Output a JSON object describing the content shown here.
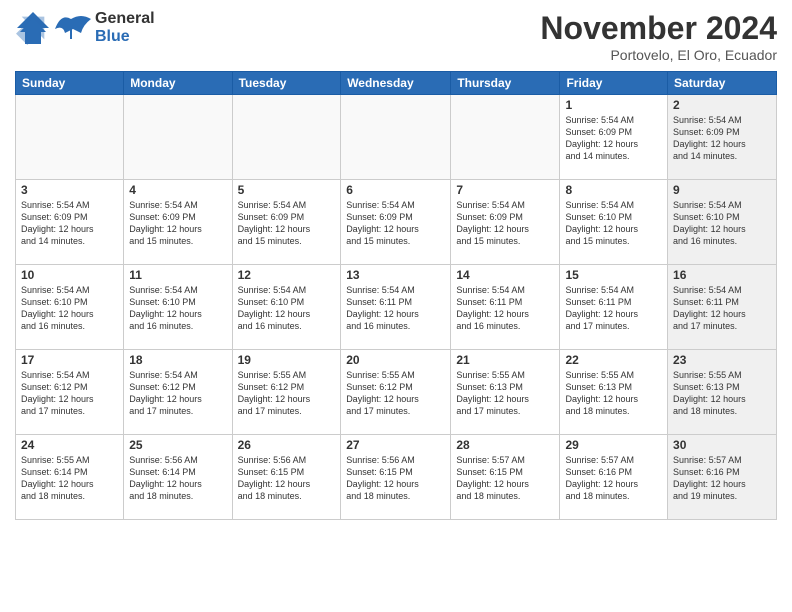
{
  "logo": {
    "line1": "General",
    "line2": "Blue"
  },
  "header": {
    "title": "November 2024",
    "subtitle": "Portovelo, El Oro, Ecuador"
  },
  "days_of_week": [
    "Sunday",
    "Monday",
    "Tuesday",
    "Wednesday",
    "Thursday",
    "Friday",
    "Saturday"
  ],
  "weeks": [
    {
      "days": [
        {
          "num": "",
          "info": "",
          "empty": true
        },
        {
          "num": "",
          "info": "",
          "empty": true
        },
        {
          "num": "",
          "info": "",
          "empty": true
        },
        {
          "num": "",
          "info": "",
          "empty": true
        },
        {
          "num": "",
          "info": "",
          "empty": true
        },
        {
          "num": "1",
          "info": "Sunrise: 5:54 AM\nSunset: 6:09 PM\nDaylight: 12 hours\nand 14 minutes.",
          "empty": false
        },
        {
          "num": "2",
          "info": "Sunrise: 5:54 AM\nSunset: 6:09 PM\nDaylight: 12 hours\nand 14 minutes.",
          "empty": false
        }
      ]
    },
    {
      "days": [
        {
          "num": "3",
          "info": "Sunrise: 5:54 AM\nSunset: 6:09 PM\nDaylight: 12 hours\nand 14 minutes.",
          "empty": false
        },
        {
          "num": "4",
          "info": "Sunrise: 5:54 AM\nSunset: 6:09 PM\nDaylight: 12 hours\nand 15 minutes.",
          "empty": false
        },
        {
          "num": "5",
          "info": "Sunrise: 5:54 AM\nSunset: 6:09 PM\nDaylight: 12 hours\nand 15 minutes.",
          "empty": false
        },
        {
          "num": "6",
          "info": "Sunrise: 5:54 AM\nSunset: 6:09 PM\nDaylight: 12 hours\nand 15 minutes.",
          "empty": false
        },
        {
          "num": "7",
          "info": "Sunrise: 5:54 AM\nSunset: 6:09 PM\nDaylight: 12 hours\nand 15 minutes.",
          "empty": false
        },
        {
          "num": "8",
          "info": "Sunrise: 5:54 AM\nSunset: 6:10 PM\nDaylight: 12 hours\nand 15 minutes.",
          "empty": false
        },
        {
          "num": "9",
          "info": "Sunrise: 5:54 AM\nSunset: 6:10 PM\nDaylight: 12 hours\nand 16 minutes.",
          "empty": false
        }
      ]
    },
    {
      "days": [
        {
          "num": "10",
          "info": "Sunrise: 5:54 AM\nSunset: 6:10 PM\nDaylight: 12 hours\nand 16 minutes.",
          "empty": false
        },
        {
          "num": "11",
          "info": "Sunrise: 5:54 AM\nSunset: 6:10 PM\nDaylight: 12 hours\nand 16 minutes.",
          "empty": false
        },
        {
          "num": "12",
          "info": "Sunrise: 5:54 AM\nSunset: 6:10 PM\nDaylight: 12 hours\nand 16 minutes.",
          "empty": false
        },
        {
          "num": "13",
          "info": "Sunrise: 5:54 AM\nSunset: 6:11 PM\nDaylight: 12 hours\nand 16 minutes.",
          "empty": false
        },
        {
          "num": "14",
          "info": "Sunrise: 5:54 AM\nSunset: 6:11 PM\nDaylight: 12 hours\nand 16 minutes.",
          "empty": false
        },
        {
          "num": "15",
          "info": "Sunrise: 5:54 AM\nSunset: 6:11 PM\nDaylight: 12 hours\nand 17 minutes.",
          "empty": false
        },
        {
          "num": "16",
          "info": "Sunrise: 5:54 AM\nSunset: 6:11 PM\nDaylight: 12 hours\nand 17 minutes.",
          "empty": false
        }
      ]
    },
    {
      "days": [
        {
          "num": "17",
          "info": "Sunrise: 5:54 AM\nSunset: 6:12 PM\nDaylight: 12 hours\nand 17 minutes.",
          "empty": false
        },
        {
          "num": "18",
          "info": "Sunrise: 5:54 AM\nSunset: 6:12 PM\nDaylight: 12 hours\nand 17 minutes.",
          "empty": false
        },
        {
          "num": "19",
          "info": "Sunrise: 5:55 AM\nSunset: 6:12 PM\nDaylight: 12 hours\nand 17 minutes.",
          "empty": false
        },
        {
          "num": "20",
          "info": "Sunrise: 5:55 AM\nSunset: 6:12 PM\nDaylight: 12 hours\nand 17 minutes.",
          "empty": false
        },
        {
          "num": "21",
          "info": "Sunrise: 5:55 AM\nSunset: 6:13 PM\nDaylight: 12 hours\nand 17 minutes.",
          "empty": false
        },
        {
          "num": "22",
          "info": "Sunrise: 5:55 AM\nSunset: 6:13 PM\nDaylight: 12 hours\nand 18 minutes.",
          "empty": false
        },
        {
          "num": "23",
          "info": "Sunrise: 5:55 AM\nSunset: 6:13 PM\nDaylight: 12 hours\nand 18 minutes.",
          "empty": false
        }
      ]
    },
    {
      "days": [
        {
          "num": "24",
          "info": "Sunrise: 5:55 AM\nSunset: 6:14 PM\nDaylight: 12 hours\nand 18 minutes.",
          "empty": false
        },
        {
          "num": "25",
          "info": "Sunrise: 5:56 AM\nSunset: 6:14 PM\nDaylight: 12 hours\nand 18 minutes.",
          "empty": false
        },
        {
          "num": "26",
          "info": "Sunrise: 5:56 AM\nSunset: 6:15 PM\nDaylight: 12 hours\nand 18 minutes.",
          "empty": false
        },
        {
          "num": "27",
          "info": "Sunrise: 5:56 AM\nSunset: 6:15 PM\nDaylight: 12 hours\nand 18 minutes.",
          "empty": false
        },
        {
          "num": "28",
          "info": "Sunrise: 5:57 AM\nSunset: 6:15 PM\nDaylight: 12 hours\nand 18 minutes.",
          "empty": false
        },
        {
          "num": "29",
          "info": "Sunrise: 5:57 AM\nSunset: 6:16 PM\nDaylight: 12 hours\nand 18 minutes.",
          "empty": false
        },
        {
          "num": "30",
          "info": "Sunrise: 5:57 AM\nSunset: 6:16 PM\nDaylight: 12 hours\nand 19 minutes.",
          "empty": false
        }
      ]
    }
  ]
}
